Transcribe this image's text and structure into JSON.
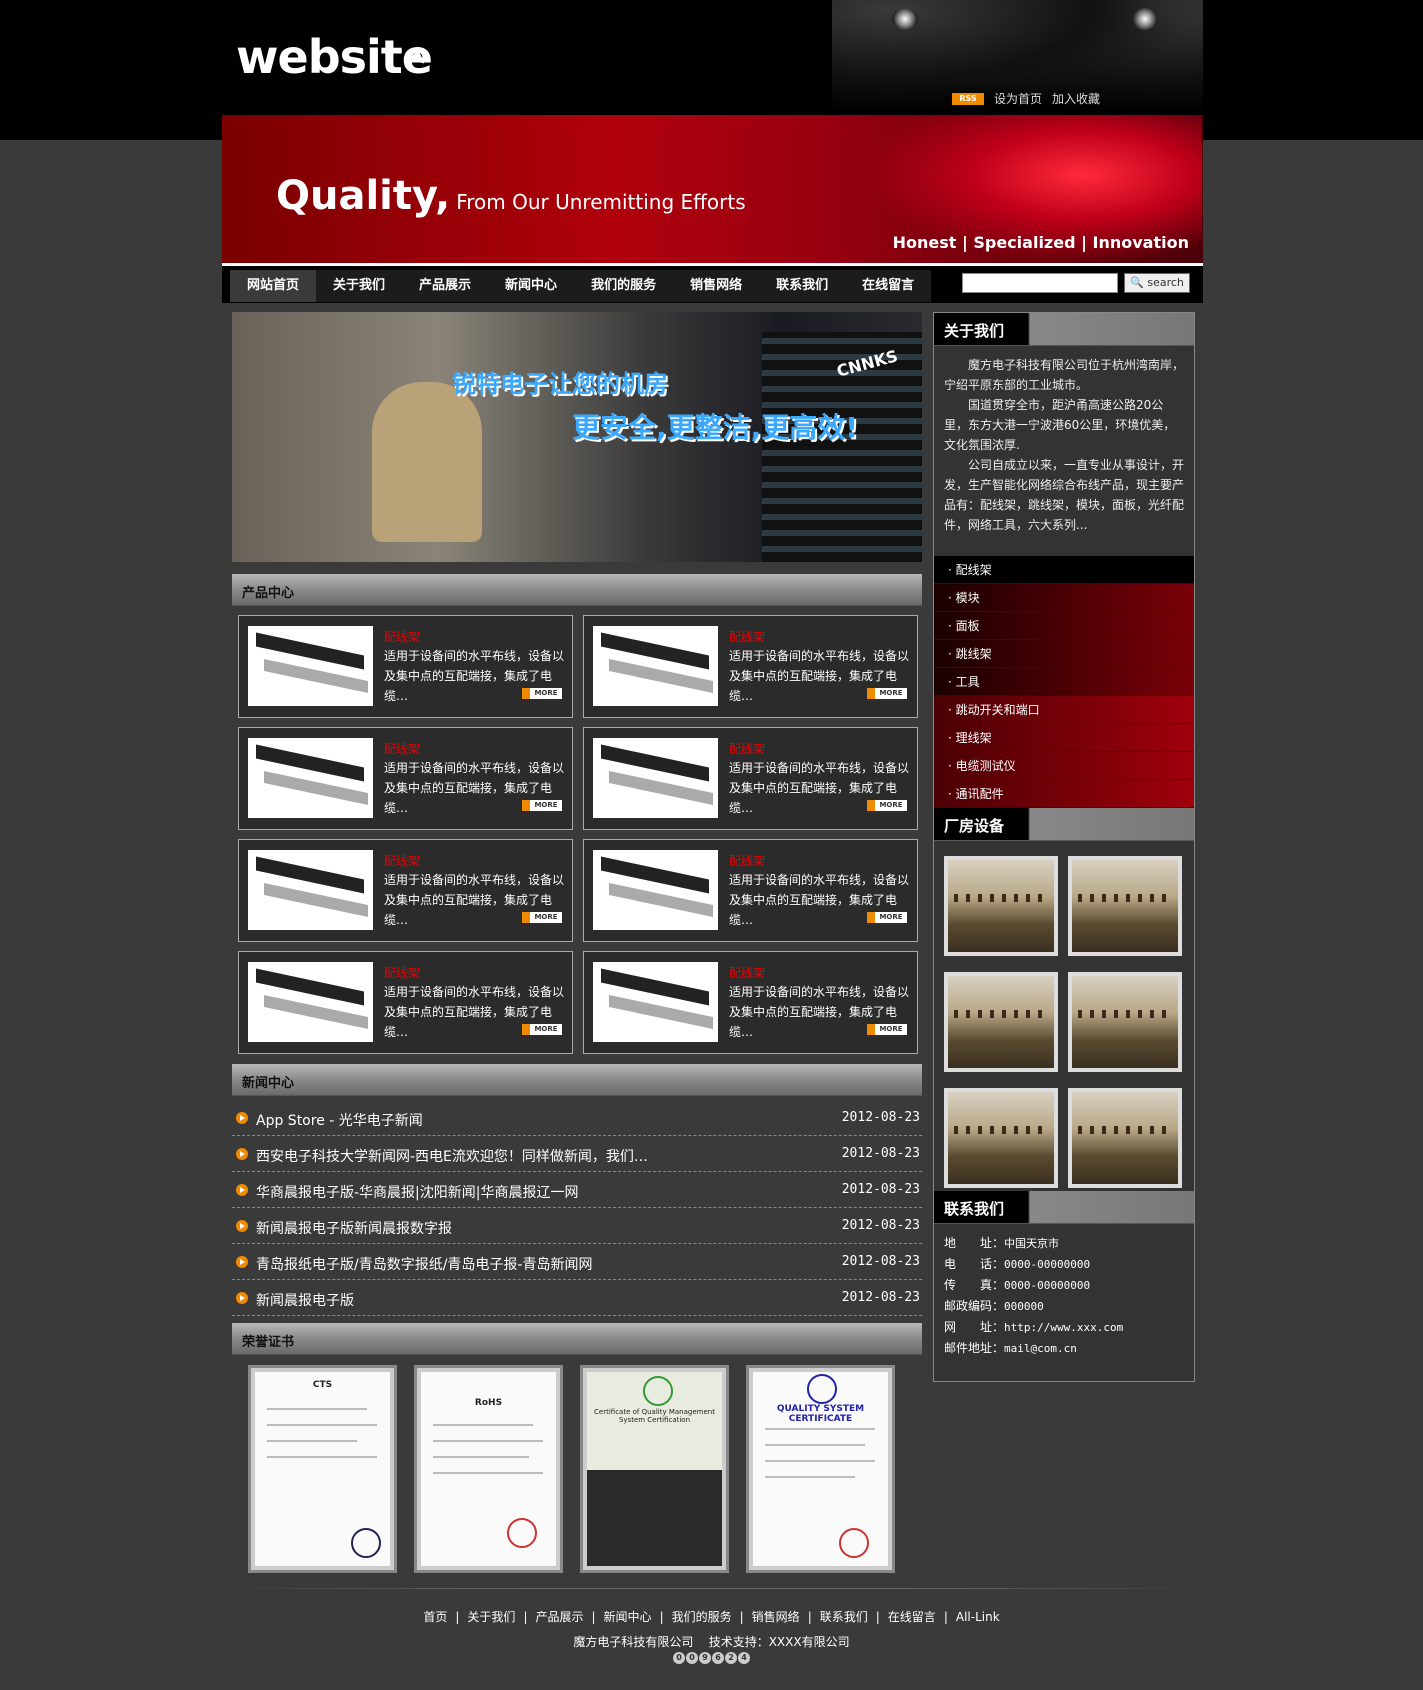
{
  "header": {
    "logo": "website",
    "rss": "RSS",
    "set_home": "设为首页",
    "add_fav": "加入收藏"
  },
  "banner": {
    "headline": "Quality,",
    "tagline": "From Our Unremitting Efforts",
    "slogan": "Honest | Specialized | Innovation"
  },
  "nav": {
    "items": [
      "网站首页",
      "关于我们",
      "产品展示",
      "新闻中心",
      "我们的服务",
      "销售网络",
      "联系我们",
      "在线留言"
    ],
    "search_button": "search"
  },
  "hero": {
    "line1": "锐特电子让您的机房",
    "line2": "更安全,更整洁,更高效!",
    "brand": "CNNKS"
  },
  "products": {
    "title": "产品中心",
    "items": [
      {
        "name": "配线架",
        "desc": "适用于设备间的水平布线，设备以及集中点的互配端接，集成了电缆…",
        "more": "MORE"
      },
      {
        "name": "配线架",
        "desc": "适用于设备间的水平布线，设备以及集中点的互配端接，集成了电缆…",
        "more": "MORE"
      },
      {
        "name": "配线架",
        "desc": "适用于设备间的水平布线，设备以及集中点的互配端接，集成了电缆…",
        "more": "MORE"
      },
      {
        "name": "配线架",
        "desc": "适用于设备间的水平布线，设备以及集中点的互配端接，集成了电缆…",
        "more": "MORE"
      },
      {
        "name": "配线架",
        "desc": "适用于设备间的水平布线，设备以及集中点的互配端接，集成了电缆…",
        "more": "MORE"
      },
      {
        "name": "配线架",
        "desc": "适用于设备间的水平布线，设备以及集中点的互配端接，集成了电缆…",
        "more": "MORE"
      },
      {
        "name": "配线架",
        "desc": "适用于设备间的水平布线，设备以及集中点的互配端接，集成了电缆…",
        "more": "MORE"
      },
      {
        "name": "配线架",
        "desc": "适用于设备间的水平布线，设备以及集中点的互配端接，集成了电缆…",
        "more": "MORE"
      }
    ]
  },
  "news": {
    "title": "新闻中心",
    "items": [
      {
        "title": "App Store - 光华电子新闻",
        "date": "2012-08-23"
      },
      {
        "title": "西安电子科技大学新闻网-西电E流欢迎您！同样做新闻，我们…",
        "date": "2012-08-23"
      },
      {
        "title": "华商晨报电子版-华商晨报|沈阳新闻|华商晨报辽一网",
        "date": "2012-08-23"
      },
      {
        "title": "新闻晨报电子版新闻晨报数字报",
        "date": "2012-08-23"
      },
      {
        "title": "青岛报纸电子版/青岛数字报纸/青岛电子报-青岛新闻网",
        "date": "2012-08-23"
      },
      {
        "title": "新闻晨报电子版",
        "date": "2012-08-23"
      }
    ]
  },
  "honors": {
    "title": "荣誉证书",
    "certs": [
      {
        "label": "CTS"
      },
      {
        "label": "RoHS"
      },
      {
        "label": "Certificate of Quality Management System Certification"
      },
      {
        "label": "QUALITY SYSTEM CERTIFICATE"
      }
    ]
  },
  "sidebar": {
    "about_title": "关于我们",
    "about_paragraphs": [
      "魔方电子科技有限公司位于杭州湾南岸，宁绍平原东部的工业城市。",
      "国道贯穿全市，距沪甬高速公路20公里，东方大港一宁波港60公里，环境优美，文化氛围浓厚.",
      "公司自成立以来，一直专业从事设计，开发，生产智能化网络综合布线产品，现主要产品有：配线架，跳线架，模块，面板，光纤配件，网络工具，六大系列..."
    ],
    "categories": [
      "配线架",
      "模块",
      "面板",
      "跳线架",
      "工具",
      "跳动开关和端口",
      "理线架",
      "电缆测试仪",
      "通讯配件"
    ],
    "factory_title": "厂房设备",
    "contact_title": "联系我们",
    "contact": [
      {
        "label": "地　　址：",
        "value": "中国天京市"
      },
      {
        "label": "电　　话：",
        "value": "0000-00000000"
      },
      {
        "label": "传　　真：",
        "value": "0000-00000000"
      },
      {
        "label": "邮政编码：",
        "value": "000000"
      },
      {
        "label": "网　　址：",
        "value": "http://www.xxx.com"
      },
      {
        "label": "邮件地址：",
        "value": "mail@com.cn"
      }
    ]
  },
  "footer": {
    "links": [
      "首页",
      "关于我们",
      "产品展示",
      "新闻中心",
      "我们的服务",
      "销售网络",
      "联系我们",
      "在线留言",
      "All-Link"
    ],
    "company": "魔方电子科技有限公司",
    "support": "技术支持：XXXX有限公司",
    "counter": [
      "0",
      "0",
      "9",
      "6",
      "2",
      "4"
    ]
  }
}
